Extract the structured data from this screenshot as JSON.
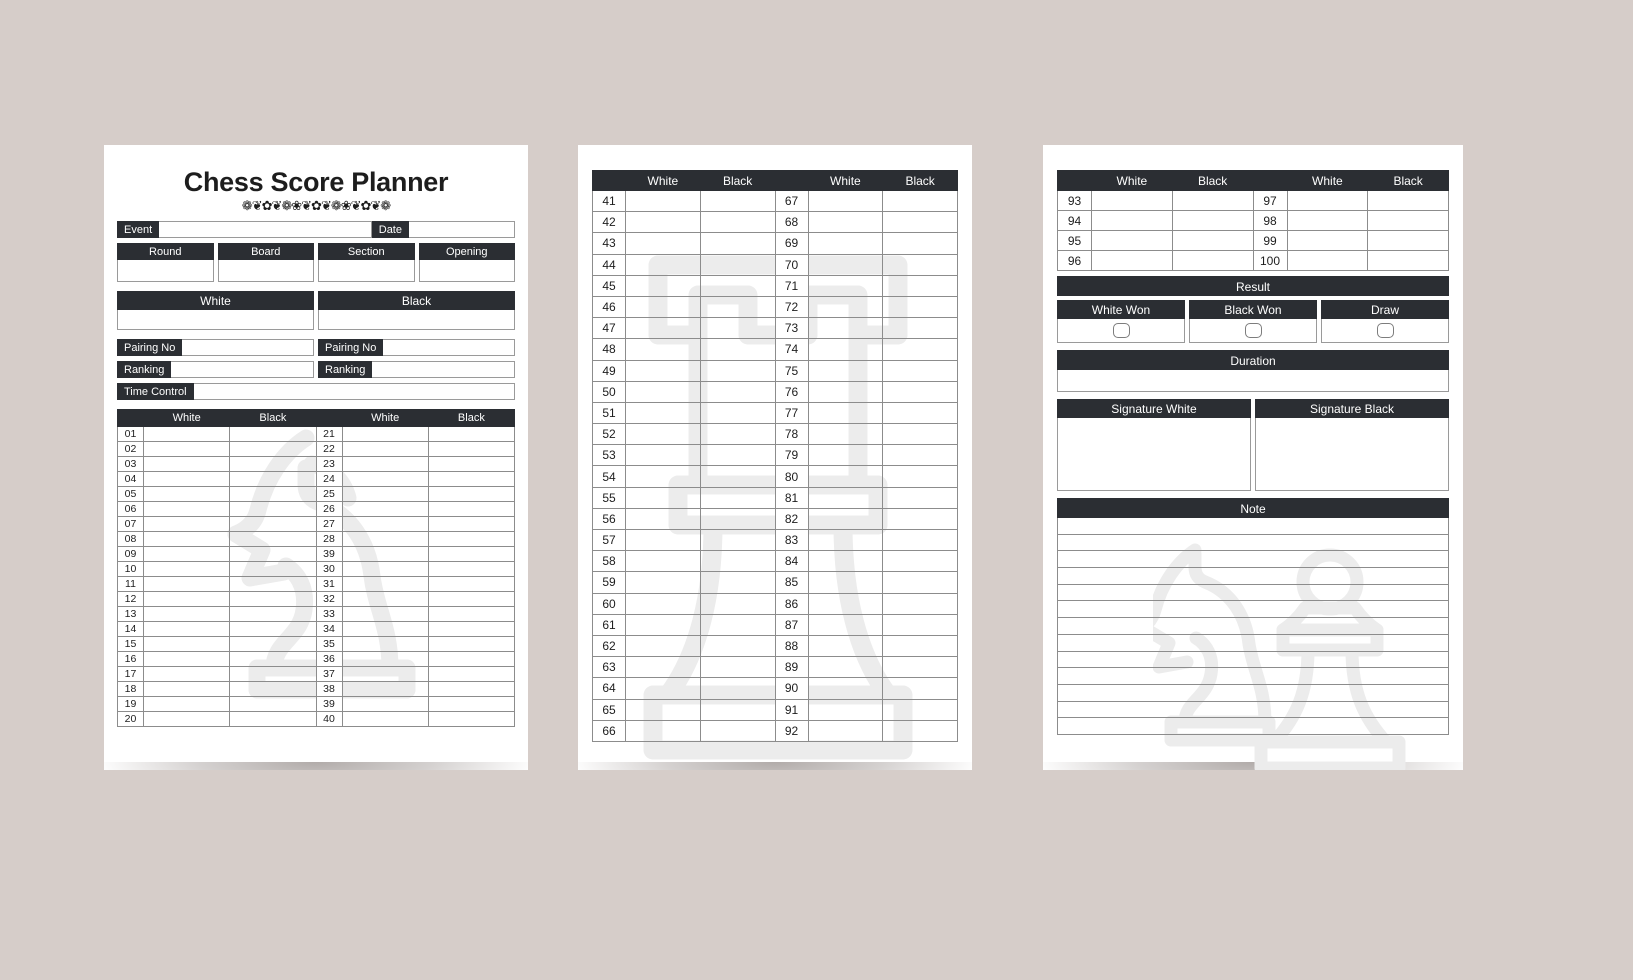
{
  "theme": {
    "background": "#d6cdc9",
    "paper": "#ffffff",
    "bar_dark": "#2b2e33",
    "bar_text": "#ffffff",
    "border": "#8c8c8c",
    "watermark": "#eceaea"
  },
  "page1": {
    "title": "Chess Score Planner",
    "ornament": "❁❦✿❦❁❀❦✿❦❁❀❦✿❦❁",
    "event_label": "Event",
    "date_label": "Date",
    "quad": [
      {
        "label": "Round"
      },
      {
        "label": "Board"
      },
      {
        "label": "Section"
      },
      {
        "label": "Opening"
      }
    ],
    "players": [
      {
        "label": "White"
      },
      {
        "label": "Black"
      }
    ],
    "pairing_label": "Pairing No",
    "ranking_label": "Ranking",
    "time_control_label": "Time Control",
    "table_headers": [
      "",
      "White",
      "Black",
      "",
      "White",
      "Black"
    ],
    "rows": [
      {
        "left": "01",
        "right": "21"
      },
      {
        "left": "02",
        "right": "22"
      },
      {
        "left": "03",
        "right": "23"
      },
      {
        "left": "04",
        "right": "24"
      },
      {
        "left": "05",
        "right": "25"
      },
      {
        "left": "06",
        "right": "26"
      },
      {
        "left": "07",
        "right": "27"
      },
      {
        "left": "08",
        "right": "28"
      },
      {
        "left": "09",
        "right": "39"
      },
      {
        "left": "10",
        "right": "30"
      },
      {
        "left": "11",
        "right": "31"
      },
      {
        "left": "12",
        "right": "32"
      },
      {
        "left": "13",
        "right": "33"
      },
      {
        "left": "14",
        "right": "34"
      },
      {
        "left": "15",
        "right": "35"
      },
      {
        "left": "16",
        "right": "36"
      },
      {
        "left": "17",
        "right": "37"
      },
      {
        "left": "18",
        "right": "38"
      },
      {
        "left": "19",
        "right": "39"
      },
      {
        "left": "20",
        "right": "40"
      }
    ]
  },
  "page2": {
    "table_headers": [
      "",
      "White",
      "Black",
      "",
      "White",
      "Black"
    ],
    "rows": [
      {
        "left": "41",
        "right": "67"
      },
      {
        "left": "42",
        "right": "68"
      },
      {
        "left": "43",
        "right": "69"
      },
      {
        "left": "44",
        "right": "70"
      },
      {
        "left": "45",
        "right": "71"
      },
      {
        "left": "46",
        "right": "72"
      },
      {
        "left": "47",
        "right": "73"
      },
      {
        "left": "48",
        "right": "74"
      },
      {
        "left": "49",
        "right": "75"
      },
      {
        "left": "50",
        "right": "76"
      },
      {
        "left": "51",
        "right": "77"
      },
      {
        "left": "52",
        "right": "78"
      },
      {
        "left": "53",
        "right": "79"
      },
      {
        "left": "54",
        "right": "80"
      },
      {
        "left": "55",
        "right": "81"
      },
      {
        "left": "56",
        "right": "82"
      },
      {
        "left": "57",
        "right": "83"
      },
      {
        "left": "58",
        "right": "84"
      },
      {
        "left": "59",
        "right": "85"
      },
      {
        "left": "60",
        "right": "86"
      },
      {
        "left": "61",
        "right": "87"
      },
      {
        "left": "62",
        "right": "88"
      },
      {
        "left": "63",
        "right": "89"
      },
      {
        "left": "64",
        "right": "90"
      },
      {
        "left": "65",
        "right": "91"
      },
      {
        "left": "66",
        "right": "92"
      }
    ]
  },
  "page3": {
    "table_headers": [
      "",
      "White",
      "Black",
      "",
      "White",
      "Black"
    ],
    "rows": [
      {
        "left": "93",
        "right": "97"
      },
      {
        "left": "94",
        "right": "98"
      },
      {
        "left": "95",
        "right": "99"
      },
      {
        "left": "96",
        "right": "100"
      }
    ],
    "result_label": "Result",
    "result_options": [
      {
        "label": "White Won"
      },
      {
        "label": "Black Won"
      },
      {
        "label": "Draw"
      }
    ],
    "duration_label": "Duration",
    "signature_white_label": "Signature White",
    "signature_black_label": "Signature Black",
    "note_label": "Note",
    "note_line_count": 13
  }
}
